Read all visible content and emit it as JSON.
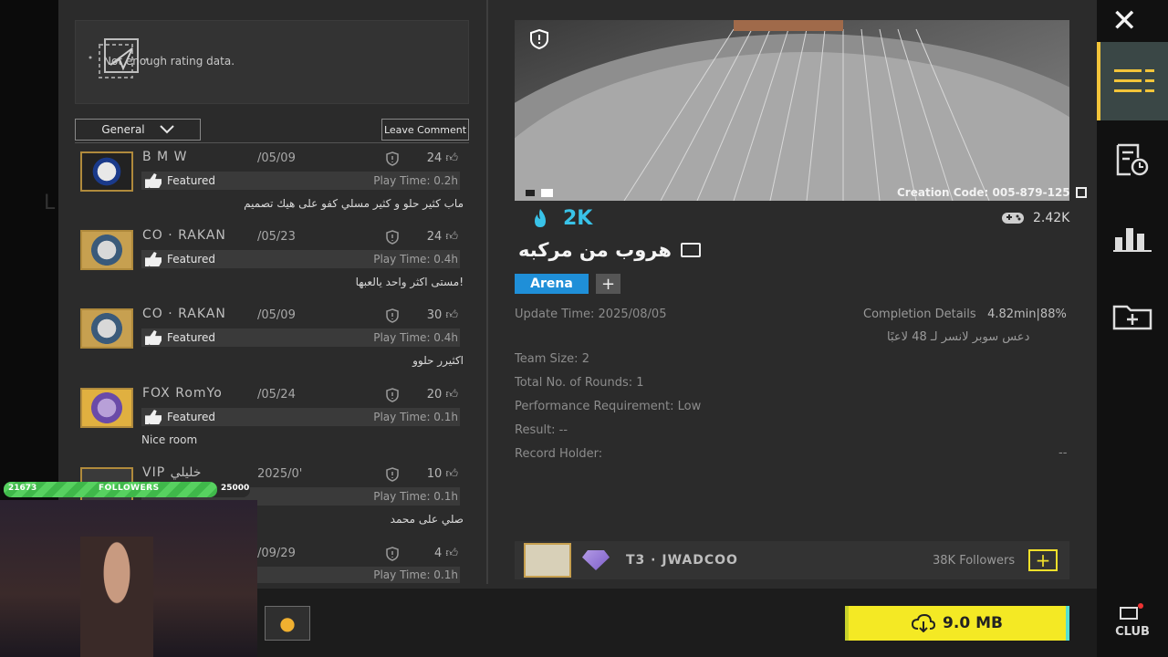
{
  "rating": {
    "text": "Not enough rating data."
  },
  "filter": {
    "selected": "General",
    "leave_comment": "Leave Comment"
  },
  "comments": [
    {
      "name": "B M W",
      "date": "/05/09",
      "likes": "24",
      "badge": "Featured",
      "playtime": "Play Time: 0.2h",
      "text": "ماب كثير حلو و كثير مسلي كفو على هيك تصميم"
    },
    {
      "name": "CO · RAKAN",
      "date": "/05/23",
      "likes": "24",
      "badge": "Featured",
      "playtime": "Play Time: 0.4h",
      "text": "مستى اكثر واحد يالعبها!"
    },
    {
      "name": "CO · RAKAN",
      "date": "/05/09",
      "likes": "30",
      "badge": "Featured",
      "playtime": "Play Time: 0.4h",
      "text": "اكثيرر حلوو"
    },
    {
      "name": "FOX RomYo",
      "date": "/05/24",
      "likes": "20",
      "badge": "Featured",
      "playtime": "Play Time: 0.1h",
      "text": "Nice room"
    },
    {
      "name": "VIP خليلي",
      "date": "2025/0'",
      "likes": "10",
      "badge": "",
      "playtime": "Play Time: 0.1h",
      "text": "صلي على محمد"
    },
    {
      "name": "",
      "date": "/09/29",
      "likes": "4",
      "badge": "",
      "playtime": "Play Time: 0.1h",
      "text": ""
    }
  ],
  "map": {
    "creation_code": "Creation Code: 005-879-125",
    "popularity": "2K",
    "plays": "2.42K",
    "title": "هروب من مركبه",
    "tag": "Arena",
    "update_time": "Update Time: 2025/08/05",
    "completion_label": "Completion Details",
    "completion_value": "4.82min|88%",
    "completion_sub": "دعس سوبر لانسر لـ 48 لاعبًا",
    "team_size": "Team Size: 2",
    "rounds": "Total No. of Rounds: 1",
    "performance": "Performance Requirement: Low",
    "result": "Result: --",
    "record_holder": "Record Holder:",
    "record_holder_value": "--"
  },
  "creator": {
    "name": "T3 · JWADCOO",
    "followers": "38K Followers",
    "follow": "+"
  },
  "download": {
    "label": "9.0 MB"
  },
  "sidebar": {
    "close": "✕",
    "club": "CLUB"
  },
  "overlay": {
    "current": "21673",
    "label": "FOLLOWERS",
    "goal": "25000",
    "progress": 0.867
  },
  "colors": {
    "accent": "#39c3e8",
    "tag": "#1f8fd8",
    "download": "#f4e924",
    "follow": "#f2e02b"
  }
}
